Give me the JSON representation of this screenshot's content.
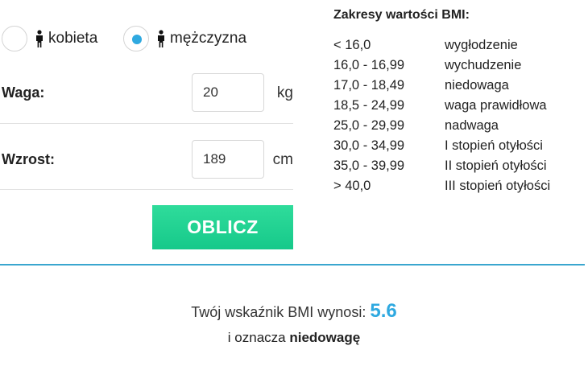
{
  "gender": {
    "female_label": "kobieta",
    "male_label": "mężczyzna",
    "selected": "male"
  },
  "weight": {
    "label": "Waga:",
    "value": "20",
    "unit": "kg"
  },
  "height": {
    "label": "Wzrost:",
    "value": "189",
    "unit": "cm"
  },
  "calculate_label": "OBLICZ",
  "ranges": {
    "title": "Zakresy wartości BMI:",
    "items": [
      {
        "range": "< 16,0",
        "name": "wygłodzenie"
      },
      {
        "range": "16,0 - 16,99",
        "name": "wychudzenie"
      },
      {
        "range": "17,0 - 18,49",
        "name": "niedowaga"
      },
      {
        "range": "18,5 - 24,99",
        "name": "waga prawidłowa"
      },
      {
        "range": "25,0 - 29,99",
        "name": "nadwaga"
      },
      {
        "range": "30,0 - 34,99",
        "name": "I stopień otyłości"
      },
      {
        "range": "35,0 - 39,99",
        "name": "II stopień otyłości"
      },
      {
        "range": "> 40,0",
        "name": "III stopień otyłości"
      }
    ]
  },
  "result": {
    "prefix": "Twój wskaźnik BMI wynosi:",
    "value": "5.6",
    "meaning_prefix": "i oznacza",
    "category": "niedowagę"
  },
  "colors": {
    "accent_blue": "#2fa9e0",
    "button_green": "#1ed291",
    "divider_blue": "#3aa6cf"
  }
}
